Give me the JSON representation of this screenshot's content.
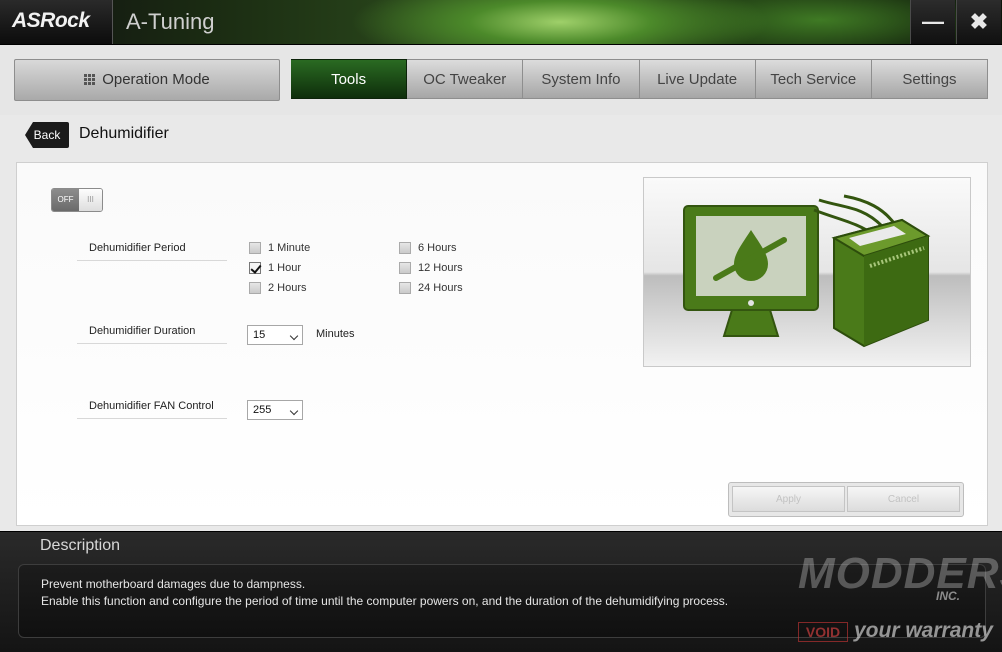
{
  "titlebar": {
    "logo": "ASRock",
    "app_title": "A-Tuning"
  },
  "nav": {
    "operation_mode": "Operation Mode",
    "tabs": [
      {
        "label": "Tools",
        "active": true
      },
      {
        "label": "OC Tweaker"
      },
      {
        "label": "System Info"
      },
      {
        "label": "Live Update"
      },
      {
        "label": "Tech Service"
      },
      {
        "label": "Settings"
      }
    ]
  },
  "header": {
    "back_label": "Back",
    "title": "Dehumidifier"
  },
  "toggle": {
    "state_label": "OFF",
    "knob_glyph": "III"
  },
  "period": {
    "label": "Dehumidifier Period",
    "options": [
      {
        "label": "1 Minute",
        "checked": false
      },
      {
        "label": "1 Hour",
        "checked": true
      },
      {
        "label": "2 Hours",
        "checked": false
      },
      {
        "label": "6 Hours",
        "checked": false
      },
      {
        "label": "12 Hours",
        "checked": false
      },
      {
        "label": "24 Hours",
        "checked": false
      }
    ]
  },
  "duration": {
    "label": "Dehumidifier Duration",
    "value": "15",
    "unit": "Minutes"
  },
  "fan": {
    "label": "Dehumidifier FAN Control",
    "value": "255"
  },
  "actions": {
    "apply": "Apply",
    "cancel": "Cancel"
  },
  "description": {
    "title": "Description",
    "line1": "Prevent motherboard damages due to dampness.",
    "line2": "Enable this function and configure the period of time until the computer powers on, and the duration of the dehumidifying process."
  },
  "watermark": {
    "main": "MODDERS",
    "inc": "INC.",
    "void": "VOID",
    "tagline": "your warranty"
  },
  "colors": {
    "accent_green": "#4e7d1c",
    "tab_active": "#1a4a15",
    "illustration_dark": "#33550f"
  }
}
